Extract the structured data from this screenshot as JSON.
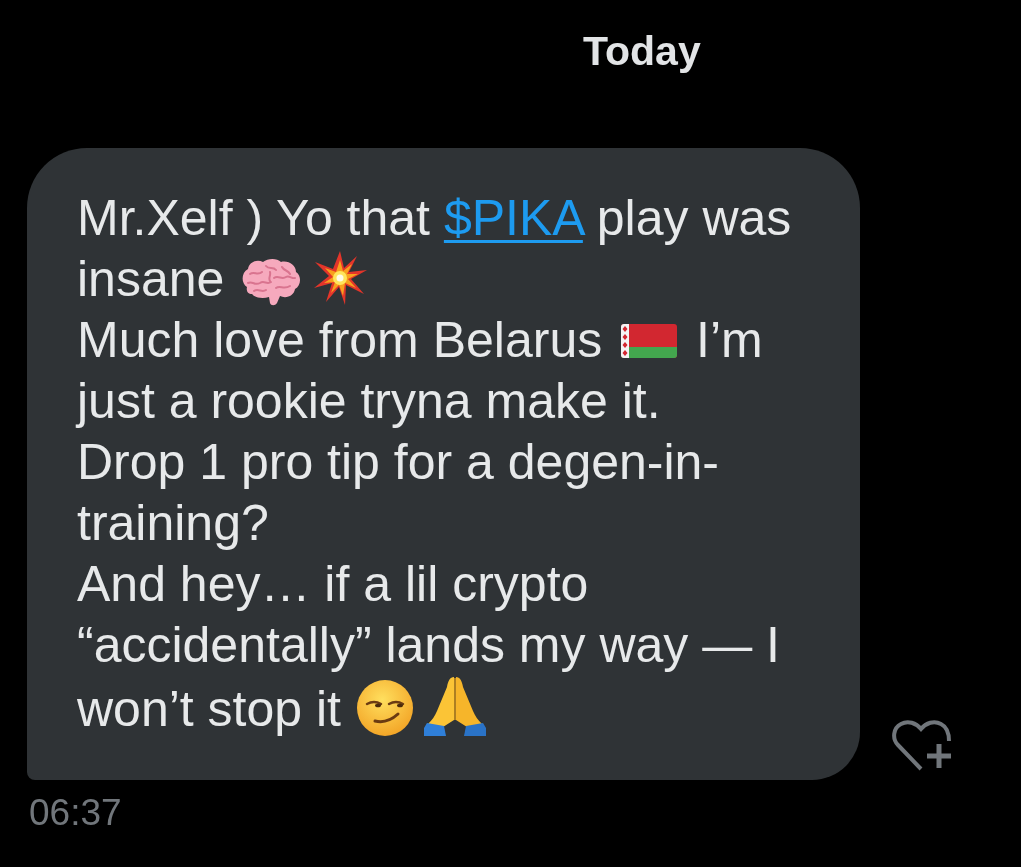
{
  "date_header": {
    "label": "Today"
  },
  "message": {
    "lines": [
      [
        {
          "kind": "text",
          "text": "Mr.Xelf ) Yo that "
        },
        {
          "kind": "link",
          "text": "$PIKA"
        },
        {
          "kind": "text",
          "text": " play was"
        }
      ],
      [
        {
          "kind": "text",
          "text": "insane "
        },
        {
          "kind": "brain"
        },
        {
          "kind": "collision"
        }
      ],
      [
        {
          "kind": "text",
          "text": "Much love from Belarus "
        },
        {
          "kind": "flag"
        },
        {
          "kind": "text",
          "text": " I’m"
        }
      ],
      [
        {
          "kind": "text",
          "text": "just a rookie tryna make it."
        }
      ],
      [
        {
          "kind": "text",
          "text": "Drop 1 pro tip for a degen-in-"
        }
      ],
      [
        {
          "kind": "text",
          "text": "training?"
        }
      ],
      [
        {
          "kind": "text",
          "text": "And hey… if a lil crypto"
        }
      ],
      [
        {
          "kind": "text",
          "text": "“accidentally” lands my way — I"
        }
      ],
      [
        {
          "kind": "text",
          "text": "won’t stop it "
        },
        {
          "kind": "smirk"
        },
        {
          "kind": "pray"
        }
      ]
    ],
    "time": "06:37"
  }
}
